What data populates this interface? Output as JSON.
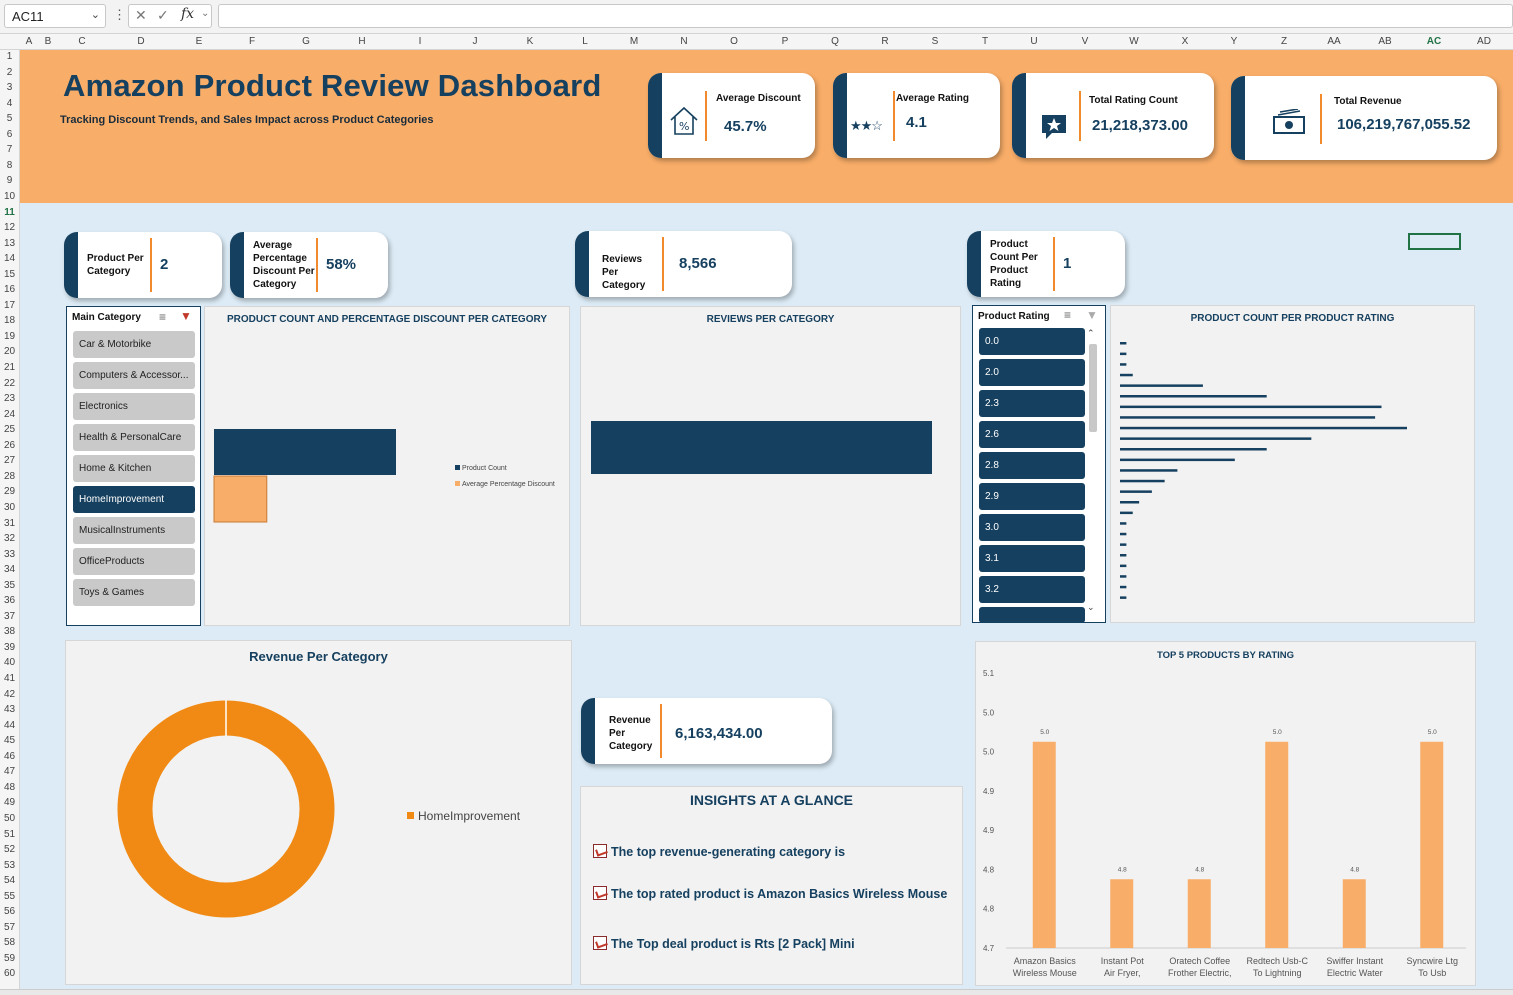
{
  "formula_bar": {
    "cell_ref": "AC11",
    "fx_label": "fx",
    "formula": ""
  },
  "columns": [
    "A",
    "B",
    "C",
    "D",
    "E",
    "F",
    "G",
    "H",
    "I",
    "J",
    "K",
    "L",
    "M",
    "N",
    "O",
    "P",
    "Q",
    "R",
    "S",
    "T",
    "U",
    "V",
    "W",
    "X",
    "Y",
    "Z",
    "AA",
    "AB",
    "AC",
    "AD"
  ],
  "rows": [
    "1",
    "2",
    "3",
    "4",
    "5",
    "6",
    "7",
    "8",
    "9",
    "10",
    "11",
    "12",
    "13",
    "14",
    "15",
    "16",
    "17",
    "18",
    "19",
    "20",
    "21",
    "22",
    "23",
    "24",
    "25",
    "26",
    "27",
    "28",
    "29",
    "30",
    "31",
    "32",
    "33",
    "34",
    "35",
    "36",
    "37",
    "38",
    "39",
    "40",
    "41",
    "42",
    "43",
    "44",
    "45",
    "46",
    "47",
    "48",
    "49",
    "50",
    "51",
    "52",
    "53",
    "54",
    "55",
    "56",
    "57",
    "58",
    "59",
    "60"
  ],
  "header": {
    "title": "Amazon Product Review Dashboard",
    "subtitle": "Tracking Discount Trends, and Sales Impact across Product Categories"
  },
  "kpis": {
    "avg_discount": {
      "label": "Average Discount",
      "value": "45.7%",
      "icon": "house-percent-icon"
    },
    "avg_rating": {
      "label": "Average Rating",
      "value": "4.1",
      "icon": "stars-icon"
    },
    "total_rating_count": {
      "label": "Total Rating Count",
      "value": "21,218,373.00",
      "icon": "star-chat-icon"
    },
    "total_revenue": {
      "label": "Total Revenue",
      "value": "106,219,767,055.52",
      "icon": "money-icon"
    }
  },
  "mini_cards": {
    "product_per_category": {
      "label": "Product Per Category",
      "value": "2"
    },
    "avg_pct_discount": {
      "label": "Average Percentage Discount Per Category",
      "value": "58%"
    },
    "reviews_per_category": {
      "label": "Reviews Per Category",
      "value": "8,566"
    },
    "product_count_per_rating": {
      "label": "Product Count Per Product Rating",
      "value": "1"
    },
    "revenue_per_category": {
      "label": "Revenue Per Category",
      "value": "6,163,434.00"
    }
  },
  "category_slicer": {
    "title": "Main Category",
    "items": [
      {
        "label": "Car & Motorbike",
        "selected": false
      },
      {
        "label": "Computers & Accessor...",
        "selected": false
      },
      {
        "label": "Electronics",
        "selected": false
      },
      {
        "label": "Health & PersonalCare",
        "selected": false
      },
      {
        "label": "Home & Kitchen",
        "selected": false
      },
      {
        "label": "HomeImprovement",
        "selected": true
      },
      {
        "label": "MusicalInstruments",
        "selected": false
      },
      {
        "label": "OfficeProducts",
        "selected": false
      },
      {
        "label": "Toys & Games",
        "selected": false
      }
    ]
  },
  "rating_slicer": {
    "title": "Product Rating",
    "items": [
      "0.0",
      "2.0",
      "2.3",
      "2.6",
      "2.8",
      "2.9",
      "3.0",
      "3.1",
      "3.2"
    ]
  },
  "colors": {
    "navy": "#16405f",
    "orange": "#f8ad68",
    "donut": "#f08a14",
    "body": "#dcebf6"
  },
  "chart_data": [
    {
      "type": "bar",
      "title": "PRODUCT COUNT AND PERCENTAGE DISCOUNT PER CATEGORY",
      "series": [
        {
          "name": "Product Count",
          "values": [
            2
          ]
        },
        {
          "name": "Average  Percentage Discount",
          "values": [
            0.58
          ]
        }
      ],
      "legend": "right"
    },
    {
      "type": "bar",
      "title": "REVIEWS PER CATEGORY",
      "values": [
        8566
      ]
    },
    {
      "type": "bar",
      "title": "PRODUCT COUNT PER PRODUCT RATING",
      "values": [
        1,
        1,
        1,
        2,
        13,
        23,
        41,
        40,
        45,
        30,
        23,
        18,
        9,
        7,
        5,
        3,
        2,
        1,
        1,
        1,
        1,
        1,
        1,
        1,
        1
      ]
    },
    {
      "type": "pie",
      "title": "Revenue Per Category",
      "categories": [
        "HomeImprovement"
      ],
      "values": [
        100
      ],
      "legend": "right"
    },
    {
      "type": "bar",
      "title": "TOP 5 PRODUCTS BY RATING",
      "categories": [
        "Amazon Basics Wireless Mouse",
        "Instant Pot Air Fryer,",
        "Oratech Coffee Frother Electric,",
        "Redtech Usb-C To Lightning",
        "Swiffer Instant Electric Water",
        "Syncwire Ltg To Usb"
      ],
      "values": [
        5.0,
        4.8,
        4.8,
        5.0,
        4.8,
        5.0
      ],
      "data_labels": [
        "5.0",
        "4.8",
        "4.8",
        "5.0",
        "4.8",
        "5.0"
      ],
      "ylim": [
        4.7,
        5.1
      ],
      "y_tick_labels": [
        "5.1",
        "5.0",
        "5.0",
        "4.9",
        "4.9",
        "4.8",
        "4.8",
        "4.7"
      ]
    }
  ],
  "insights": {
    "title": "INSIGHTS AT A GLANCE",
    "items": [
      "The top revenue-generating category is",
      "The top rated product is Amazon Basics Wireless Mouse",
      "The Top deal product is Rts [2 Pack] Mini"
    ]
  }
}
